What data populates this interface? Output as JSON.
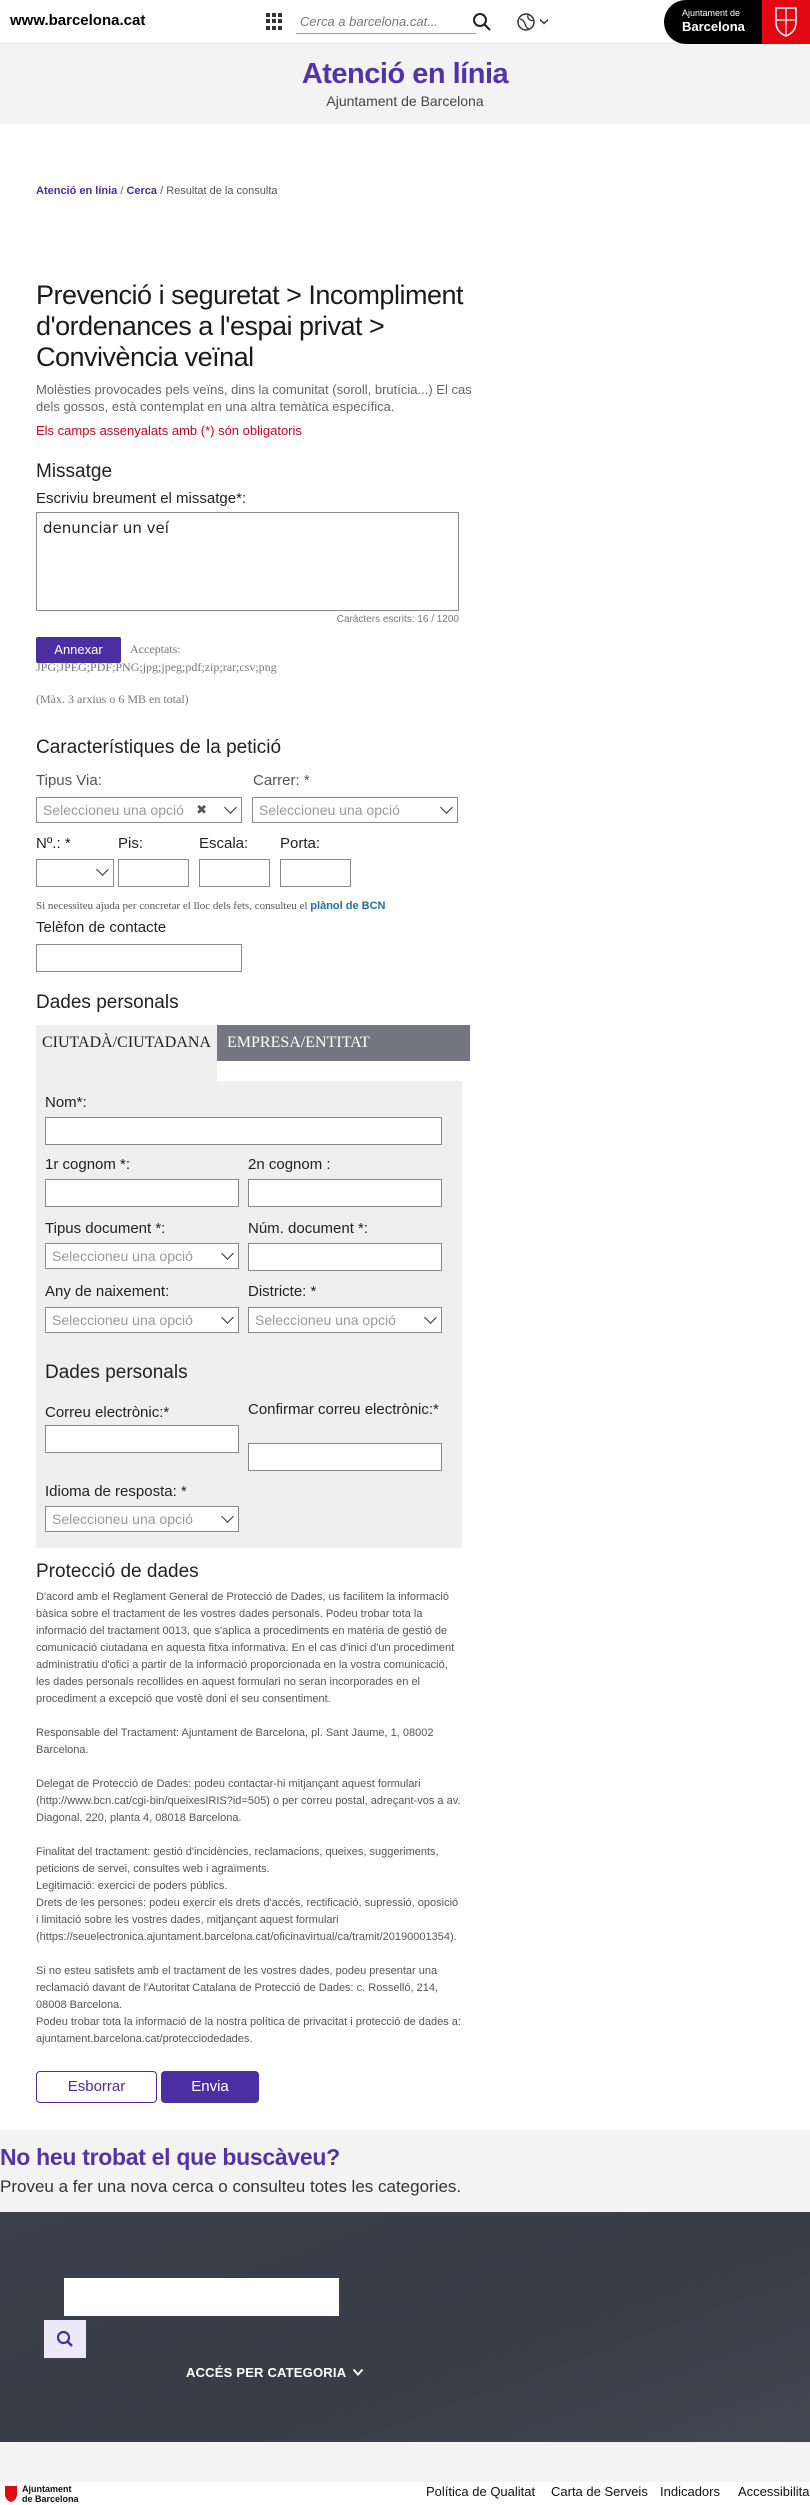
{
  "topbar": {
    "site_url": "www.barcelona.cat",
    "search_placeholder": "Cerca a barcelona.cat...",
    "logo_line1": "Ajuntament de",
    "logo_line2": "Barcelona"
  },
  "header": {
    "title": "Atenció en línia",
    "subtitle": "Ajuntament de Barcelona"
  },
  "breadcrumb": {
    "home": "Atenció en línia",
    "sep1": " / ",
    "search": "Cerca",
    "sep2": " / ",
    "current": "Resultat de la consulta"
  },
  "page": {
    "title": "Prevenció i seguretat > Incompliment d'ordenances a l'espai privat > Convivència veïnal",
    "description": "Molèsties provocades pels veïns, dins la comunitat (soroll, brutícia...) El cas dels gossos, està contemplat en una altra temàtica específica.",
    "required_note": "Els camps assenyalats amb (*) són obligatoris"
  },
  "message": {
    "heading": "Missatge",
    "label": "Escriviu breument el missatge*:",
    "value": "denunciar un veí",
    "char_count": "Caràcters escrits: 16 / 1200",
    "annex_button": "Annexar",
    "accepted_label": "Acceptats:",
    "accepted_types": "JPG;JPEG;PDF;PNG;jpg;jpeg;pdf;zip;rar;csv;png",
    "max_files": "(Màx. 3 arxius o 6 MB en total)"
  },
  "request": {
    "heading": "Característiques de la petició",
    "via_label": "Tipus Via:",
    "via_placeholder": "Seleccioneu una opció",
    "street_label": "Carrer: *",
    "street_placeholder": "Seleccioneu una opció",
    "number_label": "Nº.: *",
    "floor_label": "Pis:",
    "stair_label": "Escala:",
    "door_label": "Porta:",
    "help_text": "Si necessiteu ajuda per concretar el lloc dels fets, consulteu el ",
    "help_link": "plànol de BCN",
    "phone_label": "Telèfon de contacte"
  },
  "personal": {
    "heading": "Dades personals",
    "tab_person": "CIUTADÀ/CIUTADANA",
    "tab_company": "EMPRESA/ENTITAT",
    "name_label": "Nom*:",
    "surname1_label": "1r cognom *:",
    "surname2_label": "2n cognom :",
    "doc_type_label": "Tipus document *:",
    "doc_type_placeholder": "Seleccioneu una opció",
    "doc_num_label": "Núm. document *:",
    "birth_year_label": "Any de naixement:",
    "birth_year_placeholder": "Seleccioneu una opció",
    "district_label": "Districte: *",
    "district_placeholder": "Seleccioneu una opció",
    "sub_heading": "Dades personals",
    "email_label": "Correu electrònic:*",
    "email_confirm_label": "Confirmar correu electrònic:*",
    "language_label": "Idioma de resposta: *",
    "language_placeholder": "Seleccioneu una opció"
  },
  "protection": {
    "heading": "Protecció de dades",
    "p1": "D'acord amb el Reglament General de Protecció de Dades, us facilitem la informació bàsica sobre el tractament de les vostres dades personals. Podeu trobar tota la informació del tractament 0013, que s'aplica a procediments en matèria de gestió de comunicació ciutadana en aquesta fitxa informativa. En el cas d'inici d'un procediment administratiu d'ofici a partir de la informació proporcionada en la vostra comunicació, les dades personals recollides en aquest formulari no seran incorporades en el procediment a excepció que vostè doni el seu consentiment.",
    "p2": "Responsable del Tractament: Ajuntament de Barcelona, pl. Sant Jaume, 1, 08002 Barcelona.",
    "p3": "Delegat de Protecció de Dades: podeu contactar-hi mitjançant aquest formulari (http://www.bcn.cat/cgi-bin/queixesIRIS?id=505) o per correu postal, adreçant-vos a av. Diagonal, 220, planta 4, 08018 Barcelona.",
    "p4a": "Finalitat del tractament: gestió d'incidències, reclamacions, queixes, suggeriments, peticions de servei, consultes web i agraïments.",
    "p4b": "Legitimació: exercici de poders públics.",
    "p4c": "Drets de les persones: podeu exercir els drets d'accés, rectificació, supressió, oposició i limitació sobre les vostres dades, mitjançant aquest formulari (https://seuelectronica.ajuntament.barcelona.cat/oficinavirtual/ca/tramit/20190001354).",
    "p5a": "Si no esteu satisfets amb el tractament de les vostres dades, podeu presentar una reclamació davant de l'Autoritat Catalana de Protecció de Dades: c. Rosselló, 214, 08008 Barcelona.",
    "p5b": "Podeu trobar tota la informació de la nostra política de privacitat i protecció de dades a: ajuntament.barcelona.cat/protecciodedades.",
    "clear_button": "Esborrar",
    "send_button": "Envia"
  },
  "notfound": {
    "title": "No heu trobat el que buscàveu?",
    "text": "Proveu a fer una nova cerca o consulteu totes les categories."
  },
  "footer": {
    "category_link": "ACCÉS PER CATEGORIA",
    "logo_line1": "Ajuntament",
    "logo_line2": "de Barcelona",
    "links": [
      "Política de Qualitat",
      "Carta de Serveis",
      "Indicadors",
      "Accessibilitat"
    ]
  },
  "colors": {
    "brand_purple": "#5135a8",
    "button_purple": "#4a2fa3",
    "required_red": "#d0021b",
    "logo_red": "#e30613"
  }
}
